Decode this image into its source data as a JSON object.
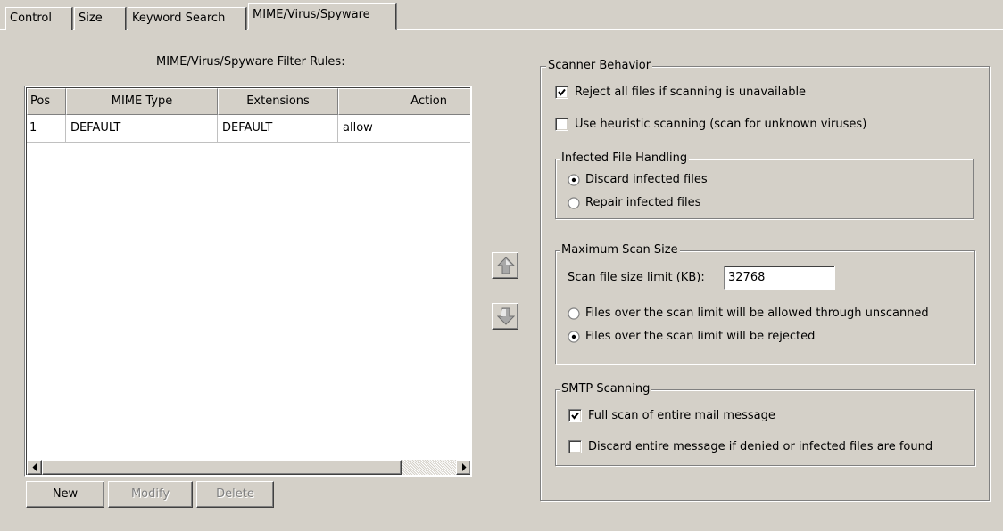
{
  "tabs": [
    {
      "label": "Control"
    },
    {
      "label": "Size"
    },
    {
      "label": "Keyword Search"
    },
    {
      "label": "MIME/Virus/Spyware",
      "active": true
    }
  ],
  "rules": {
    "caption": "MIME/Virus/Spyware Filter Rules:",
    "columns": [
      "Pos",
      "MIME Type",
      "Extensions",
      "Action"
    ],
    "rows": [
      [
        "1",
        "DEFAULT",
        "DEFAULT",
        "allow"
      ]
    ],
    "buttons": {
      "new": "New",
      "modify": "Modify",
      "delete": "Delete"
    },
    "move_up_icon": "up-arrow-icon",
    "move_down_icon": "down-arrow-icon"
  },
  "scanner": {
    "legend": "Scanner Behavior",
    "reject_all": {
      "label": "Reject all files if scanning is unavailable",
      "checked": true
    },
    "heuristic": {
      "label": "Use heuristic scanning (scan for unknown viruses)",
      "checked": false
    },
    "infected": {
      "legend": "Infected File Handling",
      "options": [
        {
          "label": "Discard infected files",
          "selected": true
        },
        {
          "label": "Repair infected files",
          "selected": false
        }
      ]
    },
    "max_scan": {
      "legend": "Maximum Scan Size",
      "limit_label": "Scan file size limit (KB):",
      "limit_value": "32768",
      "options": [
        {
          "label": "Files over the scan limit will be allowed through unscanned",
          "selected": false
        },
        {
          "label": "Files over the scan limit will be rejected",
          "selected": true
        }
      ]
    },
    "smtp": {
      "legend": "SMTP Scanning",
      "full_scan": {
        "label": "Full scan of entire mail message",
        "checked": true
      },
      "discard_entire": {
        "label": "Discard entire message if denied or infected files are found",
        "checked": false
      }
    }
  }
}
